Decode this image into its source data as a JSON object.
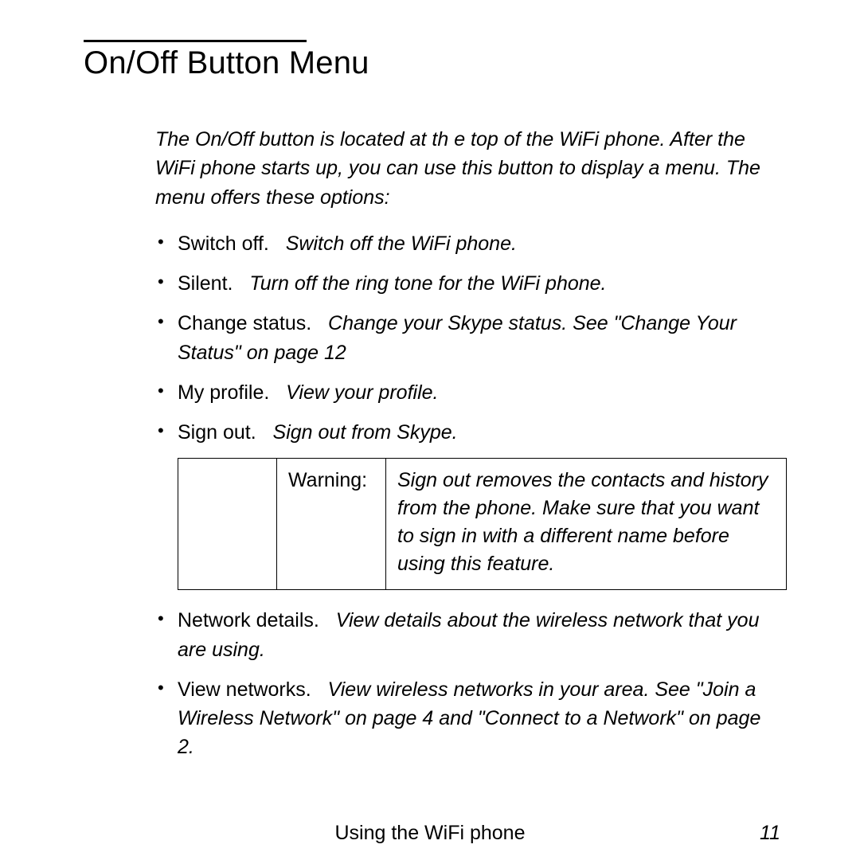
{
  "title": "On/Off Button Menu",
  "intro": "The On/Off button is located at th e top of the WiFi phone. After the WiFi phone starts up, you can use this button to display a menu. The menu offers these options:",
  "items1": [
    {
      "label": "Switch off.",
      "desc": "Switch off the WiFi phone."
    },
    {
      "label": "Silent.",
      "desc": "Turn off the ring tone for the WiFi phone."
    },
    {
      "label": "Change status.",
      "desc": "Change your Skype status. See \"Change Your Status\" on page 12"
    },
    {
      "label": "My profile.",
      "desc": "View your profile."
    },
    {
      "label": "Sign out.",
      "desc": "Sign out from Skype."
    }
  ],
  "warning": {
    "label": "Warning:",
    "text": "Sign out removes the contacts and history from the phone. Make sure that you want to sign in with a different name before using this feature."
  },
  "items2": [
    {
      "label": "Network details.",
      "desc": "View details about the wireless network that you are using."
    },
    {
      "label": "View networks.",
      "desc": "View wireless networks in your area. See \"Join a Wireless Network\" on page 4 and \"Connect to a Network\" on page 2."
    }
  ],
  "footer": {
    "center": "Using the WiFi phone",
    "page": "11"
  }
}
